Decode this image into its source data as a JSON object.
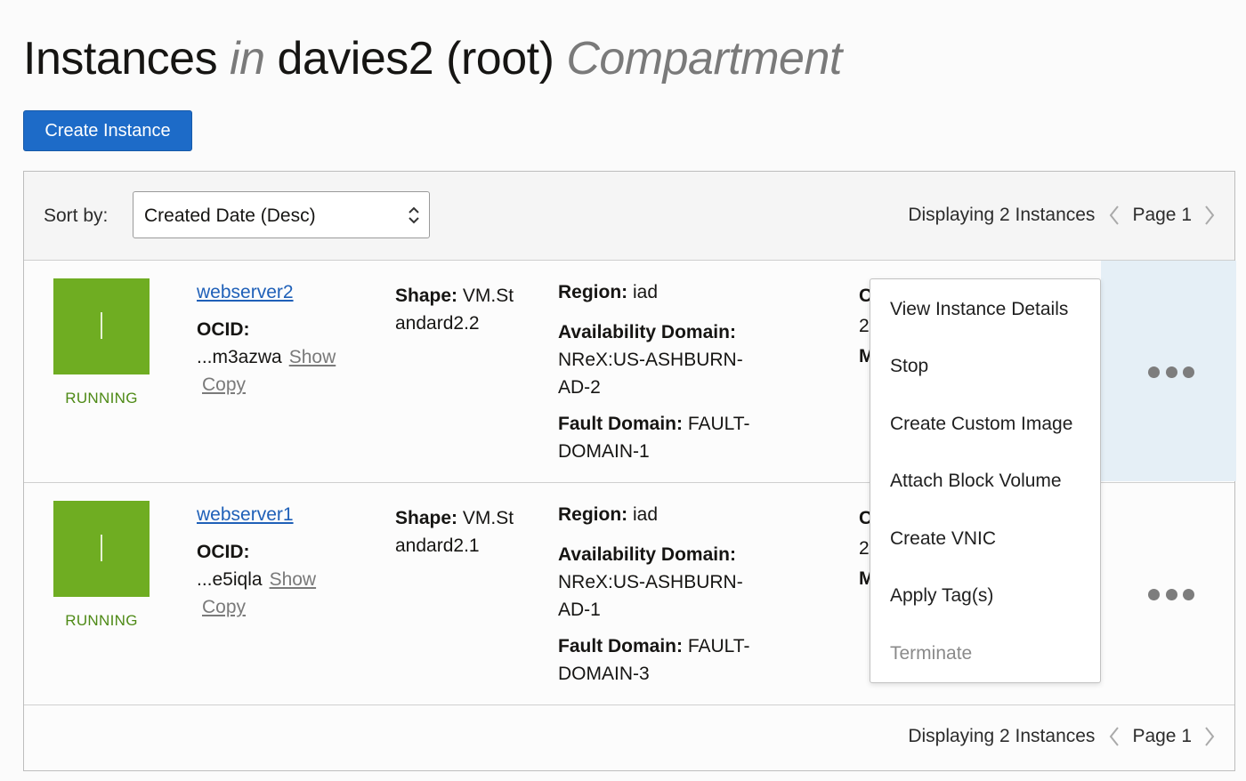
{
  "header": {
    "title_part1": "Instances",
    "title_in": "in",
    "title_part2": "davies2 (root)",
    "title_compartment": "Compartment"
  },
  "create_button": "Create Instance",
  "toolbar": {
    "sort_label": "Sort by:",
    "sort_value": "Created Date (Desc)"
  },
  "pagination": {
    "count_text": "Displaying 2 Instances",
    "page_text": "Page 1"
  },
  "instances": [
    {
      "name": "webserver2",
      "status": "RUNNING",
      "ocid_label": "OCID:",
      "ocid_short": "...m3azwa",
      "show_label": "Show",
      "copy_label": "Copy",
      "shape_label": "Shape:",
      "shape_value": "VM.St andard2.2",
      "region_label": "Region:",
      "region_value": "iad",
      "ad_label": "Availability Domain:",
      "ad_value": "NReX:US-ASHBURN-AD-2",
      "fd_label": "Fault Domain:",
      "fd_value": "FAULT-DOMAIN-1",
      "clipped": [
        "C",
        "2",
        "M"
      ]
    },
    {
      "name": "webserver1",
      "status": "RUNNING",
      "ocid_label": "OCID:",
      "ocid_short": "...e5iqla",
      "show_label": "Show",
      "copy_label": "Copy",
      "shape_label": "Shape:",
      "shape_value": "VM.St andard2.1",
      "region_label": "Region:",
      "region_value": "iad",
      "ad_label": "Availability Domain:",
      "ad_value": "NReX:US-ASHBURN-AD-1",
      "fd_label": "Fault Domain:",
      "fd_value": "FAULT-DOMAIN-3",
      "clipped": [
        "C",
        "2",
        "M"
      ]
    }
  ],
  "actions_menu": [
    "View Instance Details",
    "Stop",
    "Create Custom Image",
    "Attach Block Volume",
    "Create VNIC",
    "Apply Tag(s)",
    "Terminate"
  ],
  "colors": {
    "primary": "#1d6bc8",
    "running": "#6fad22",
    "running_text": "#4e8a16",
    "link": "#1f60b8",
    "row_highlight": "#e5eff6"
  }
}
